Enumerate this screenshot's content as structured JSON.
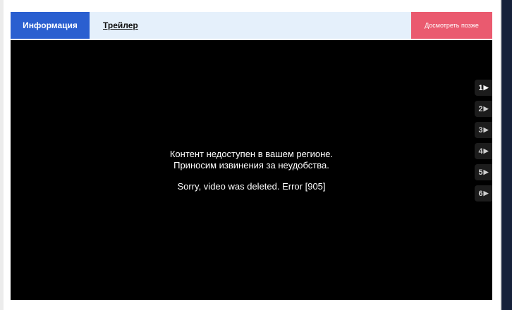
{
  "tabs": {
    "info_label": "Информация",
    "trailer_label": "Трейлер"
  },
  "actions": {
    "watch_later_label": "Досмотреть позже"
  },
  "player": {
    "message_line1": "Контент недоступен в вашем регионе.",
    "message_line2": "Приносим извинения за неудобства.",
    "error_text": "Sorry, video was deleted. Error [905]",
    "episodes": [
      {
        "number": "1",
        "icon": "play-triangle-icon",
        "active": true
      },
      {
        "number": "2",
        "icon": "play-triangle-icon",
        "active": false
      },
      {
        "number": "3",
        "icon": "play-triangle-icon",
        "active": false
      },
      {
        "number": "4",
        "icon": "play-triangle-icon",
        "active": false
      },
      {
        "number": "5",
        "icon": "play-triangle-icon",
        "active": false
      },
      {
        "number": "6",
        "icon": "play-triangle-icon",
        "active": false
      }
    ]
  },
  "colors": {
    "tab_active_bg": "#2a5fd0",
    "tabbar_bg": "#e5f0fb",
    "watch_later_bg": "#ea5a6f",
    "player_bg": "#000000",
    "right_strip_bg": "#16213a"
  }
}
